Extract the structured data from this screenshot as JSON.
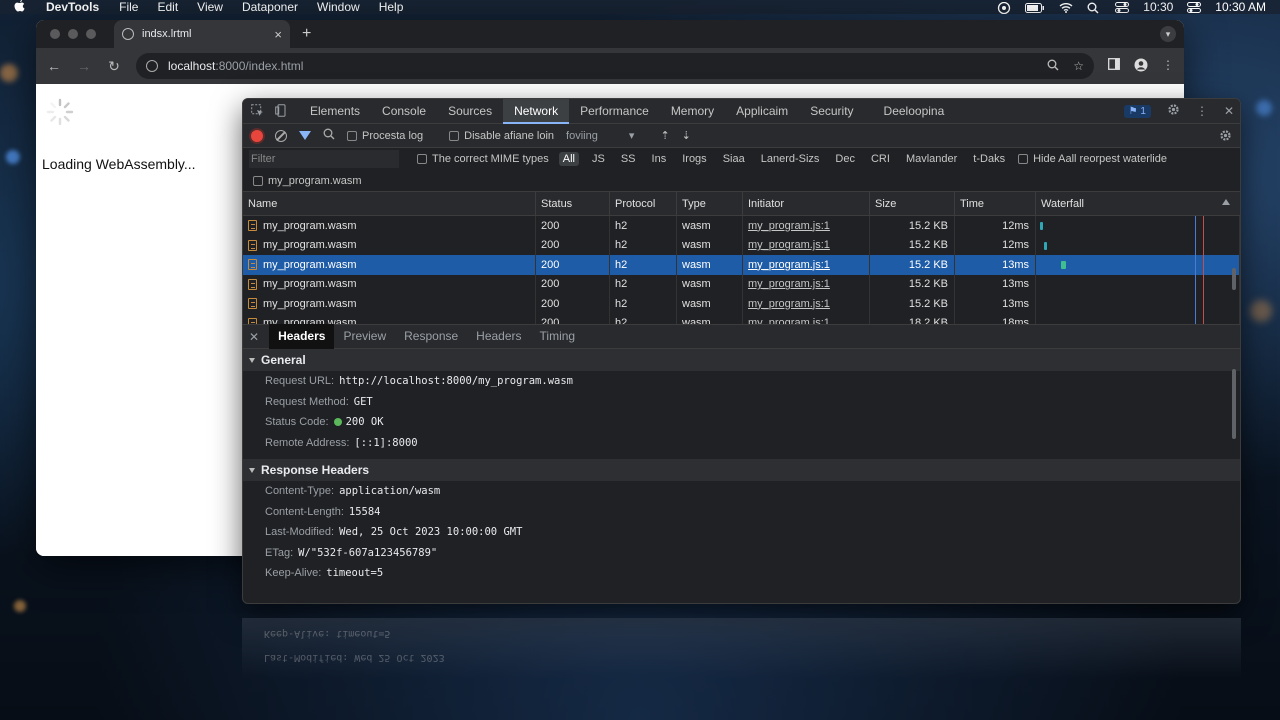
{
  "menubar": {
    "app_name": "DevTools",
    "items": [
      "File",
      "Edit",
      "View",
      "Dataponer",
      "Window",
      "Help"
    ],
    "time_1": "10:30",
    "time_2": "10:30 AM"
  },
  "browser": {
    "tab_title": "indsx.lrtml",
    "url_host": "localhost",
    "url_path": ":8000/index.html",
    "page_loading_text": "Loading WebAssembly..."
  },
  "devtools": {
    "tabs": [
      "Elements",
      "Console",
      "Sources",
      "Network",
      "Performance",
      "Memory",
      "Applicaim",
      "Security",
      "Deeloopina"
    ],
    "active_tab": "Network",
    "issues_count": "1",
    "toolbar": {
      "preserve_log": "Procesta log",
      "disable_cache": "Disable afiane loin",
      "throttling": "foviing"
    },
    "filter": {
      "placeholder": "Filter",
      "invert": "The correct MIME types",
      "types": [
        "All",
        "JS",
        "SS",
        "Ins",
        "Irogs",
        "Siaa",
        "Lanerd-Sizs",
        "Dec",
        "CRI",
        "Mavlander",
        "t-Daks"
      ],
      "hide_option": "Hide Aall reorpest waterlide",
      "second_row": "my_program.wasm"
    },
    "columns": [
      "Name",
      "Status",
      "Protocol",
      "Type",
      "Initiator",
      "Size",
      "Time",
      "Waterfall"
    ],
    "rows": [
      {
        "name": "my_program.wasm",
        "status": "200",
        "protocol": "h2",
        "type": "wasm",
        "initiator": "my_program.js:1",
        "size": "15.2 KB",
        "time": "12ms",
        "wf_start": 0.02,
        "wf_len": 0.01
      },
      {
        "name": "my_program.wasm",
        "status": "200",
        "protocol": "h2",
        "type": "wasm",
        "initiator": "my_program.js:1",
        "size": "15.2 KB",
        "time": "12ms",
        "wf_start": 0.04,
        "wf_len": 0.01
      },
      {
        "name": "my_program.wasm",
        "status": "200",
        "protocol": "h2",
        "type": "wasm",
        "initiator": "my_program.js:1",
        "size": "15.2 KB",
        "time": "13ms",
        "wf_start": 0.13,
        "wf_len": 0.03,
        "selected": true
      },
      {
        "name": "my_program.wasm",
        "status": "200",
        "protocol": "h2",
        "type": "wasm",
        "initiator": "my_program.js:1",
        "size": "15.2 KB",
        "time": "13ms"
      },
      {
        "name": "my_program.wasm",
        "status": "200",
        "protocol": "h2",
        "type": "wasm",
        "initiator": "my_program.js:1",
        "size": "15.2 KB",
        "time": "13ms"
      },
      {
        "name": "my_program.wasm",
        "status": "200",
        "protocol": "h2",
        "type": "wasm",
        "initiator": "my_program.js:1",
        "size": "18.2 KB",
        "time": "18ms"
      }
    ],
    "detail_tabs": [
      "Headers",
      "Preview",
      "Response",
      "Headers",
      "Timing"
    ],
    "general": {
      "title": "General",
      "request_url_k": "Request URL:",
      "request_url_v": "http://localhost:8000/my_program.wasm",
      "method_k": "Request Method:",
      "method_v": "GET",
      "status_k": "Status Code:",
      "status_v": "200 OK",
      "remote_k": "Remote Address:",
      "remote_v": "[::1]:8000"
    },
    "response_headers": {
      "title": "Response Headers",
      "items": [
        {
          "k": "Content-Type:",
          "v": "application/wasm"
        },
        {
          "k": "Content-Length:",
          "v": "15584"
        },
        {
          "k": "Last-Modified:",
          "v": "Wed, 25 Oct 2023 10:00:00 GMT"
        },
        {
          "k": "ETag:",
          "v": "W/\"532f-607a123456789\""
        },
        {
          "k": "Keep-Alive:",
          "v": "timeout=5"
        }
      ]
    }
  },
  "reflection": {
    "line_1": "Keep-Alive: timeout=5",
    "line_2": "Last-Modified: Wed 25 Oct 2023"
  },
  "colors": {
    "selected_row": "#1e5ca8",
    "record_red": "#e8453c",
    "status_green": "#5bb85b",
    "accent_blue": "#8ab4f8"
  }
}
